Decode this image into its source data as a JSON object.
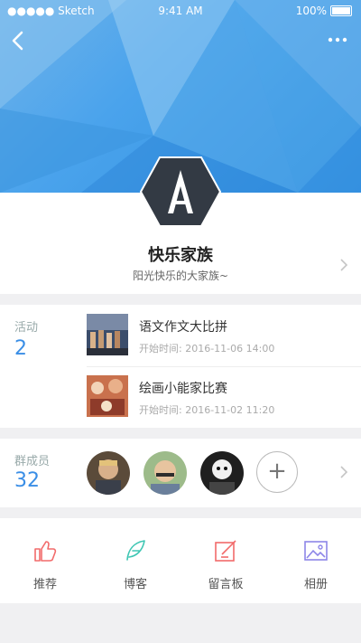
{
  "status_bar": {
    "carrier": "●●●●● Sketch",
    "time": "9:41 AM",
    "battery": "100%"
  },
  "group": {
    "name": "快乐家族",
    "description": "阳光快乐的大家族~"
  },
  "activity": {
    "label": "活动",
    "count": "2",
    "items": [
      {
        "title": "语文作文大比拼",
        "time_label": "开始时间:",
        "time": "2016-11-06 14:00"
      },
      {
        "title": "绘画小能家比赛",
        "time_label": "开始时间:",
        "time": "2016-11-02 11:20"
      }
    ]
  },
  "members": {
    "label": "群成员",
    "count": "32",
    "add_icon": "+"
  },
  "actions": [
    {
      "label": "推荐",
      "icon": "thumbs-up-icon",
      "color": "#f26b6b"
    },
    {
      "label": "博客",
      "icon": "feather-icon",
      "color": "#3ec6b3"
    },
    {
      "label": "留言板",
      "icon": "edit-icon",
      "color": "#f26b6b"
    },
    {
      "label": "相册",
      "icon": "image-icon",
      "color": "#8d86e8"
    }
  ],
  "colors": {
    "accent": "#3a8ee6",
    "header": "#4aa3ec"
  }
}
